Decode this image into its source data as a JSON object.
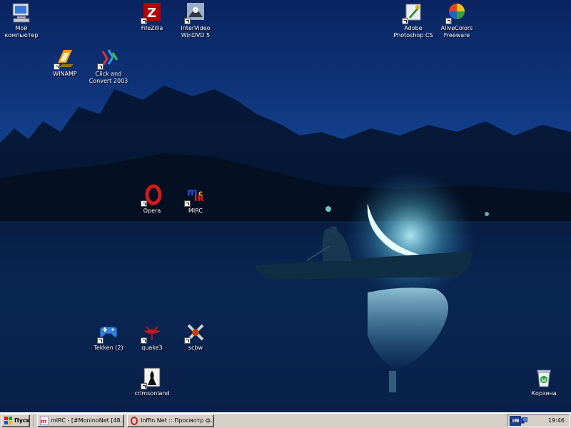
{
  "desktop": {
    "icons": [
      {
        "id": "my-computer",
        "label_lines": [
          "Мой",
          "компьютер"
        ]
      },
      {
        "id": "filezilla",
        "label_lines": [
          "FileZilla"
        ]
      },
      {
        "id": "windvd",
        "label_lines": [
          "InterVideo",
          "WinDVD 5"
        ]
      },
      {
        "id": "photoshop",
        "label_lines": [
          "Adobe",
          "Photoshop CS"
        ]
      },
      {
        "id": "alivecolors",
        "label_lines": [
          "AliveColors",
          "Freeware"
        ]
      },
      {
        "id": "winamp",
        "label_lines": [
          "WINAMP"
        ]
      },
      {
        "id": "clickconvert",
        "label_lines": [
          "Click and",
          "Convert 2003"
        ]
      },
      {
        "id": "opera",
        "label_lines": [
          "Opera"
        ]
      },
      {
        "id": "mirc",
        "label_lines": [
          "MIRC"
        ]
      },
      {
        "id": "tekken",
        "label_lines": [
          "Tekken (2)"
        ]
      },
      {
        "id": "quake3",
        "label_lines": [
          "quake3"
        ]
      },
      {
        "id": "scbw",
        "label_lines": [
          "scbw"
        ]
      },
      {
        "id": "crimsonland",
        "label_lines": [
          "crimsonland"
        ]
      },
      {
        "id": "recycle-bin",
        "label_lines": [
          "Корзина"
        ]
      }
    ]
  },
  "taskbar": {
    "start_label": "Пуск",
    "tasks": [
      {
        "label": "mIRC - [#MoninoNet [48...",
        "icon": "mirc-icon"
      },
      {
        "label": "Inffin.Net :: Просмотр ф...",
        "icon": "opera-icon"
      }
    ],
    "language": "EN",
    "tray_expand": "«",
    "clock": "19:46"
  }
}
